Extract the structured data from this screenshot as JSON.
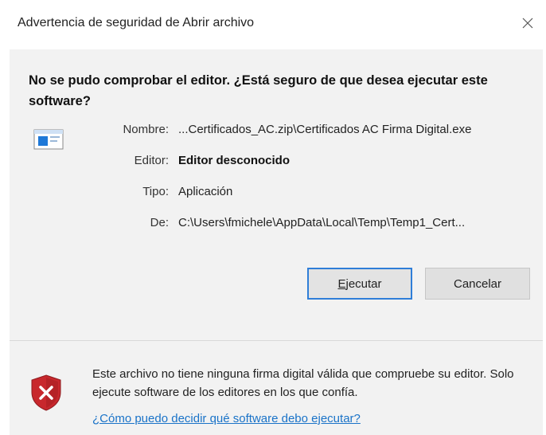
{
  "window": {
    "title": "Advertencia de seguridad de Abrir archivo",
    "close_icon": "close-icon"
  },
  "main": {
    "heading": "No se pudo comprobar el editor. ¿Está seguro de que desea ejecutar este software?",
    "file_icon": "executable-file-icon",
    "fields": {
      "name_label": "Nombre:",
      "name_value": "...Certificados_AC.zip\\Certificados AC Firma Digital.exe",
      "publisher_label": "Editor:",
      "publisher_value": "Editor desconocido",
      "type_label": "Tipo:",
      "type_value": "Aplicación",
      "from_label": "De:",
      "from_value": "C:\\Users\\fmichele\\AppData\\Local\\Temp\\Temp1_Cert..."
    },
    "buttons": {
      "run_mnemonic": "E",
      "run_rest": "jecutar",
      "cancel": "Cancelar"
    }
  },
  "footer": {
    "shield_icon": "security-shield-warning-icon",
    "warning_text": "Este archivo no tiene ninguna firma digital válida que compruebe su editor. Solo ejecute software de los editores en los que confía.",
    "help_link": "¿Cómo puedo decidir qué software debo ejecutar?"
  },
  "colors": {
    "accent_border": "#2f7ed8",
    "link": "#1a73c8",
    "shield_red": "#c8282d"
  }
}
